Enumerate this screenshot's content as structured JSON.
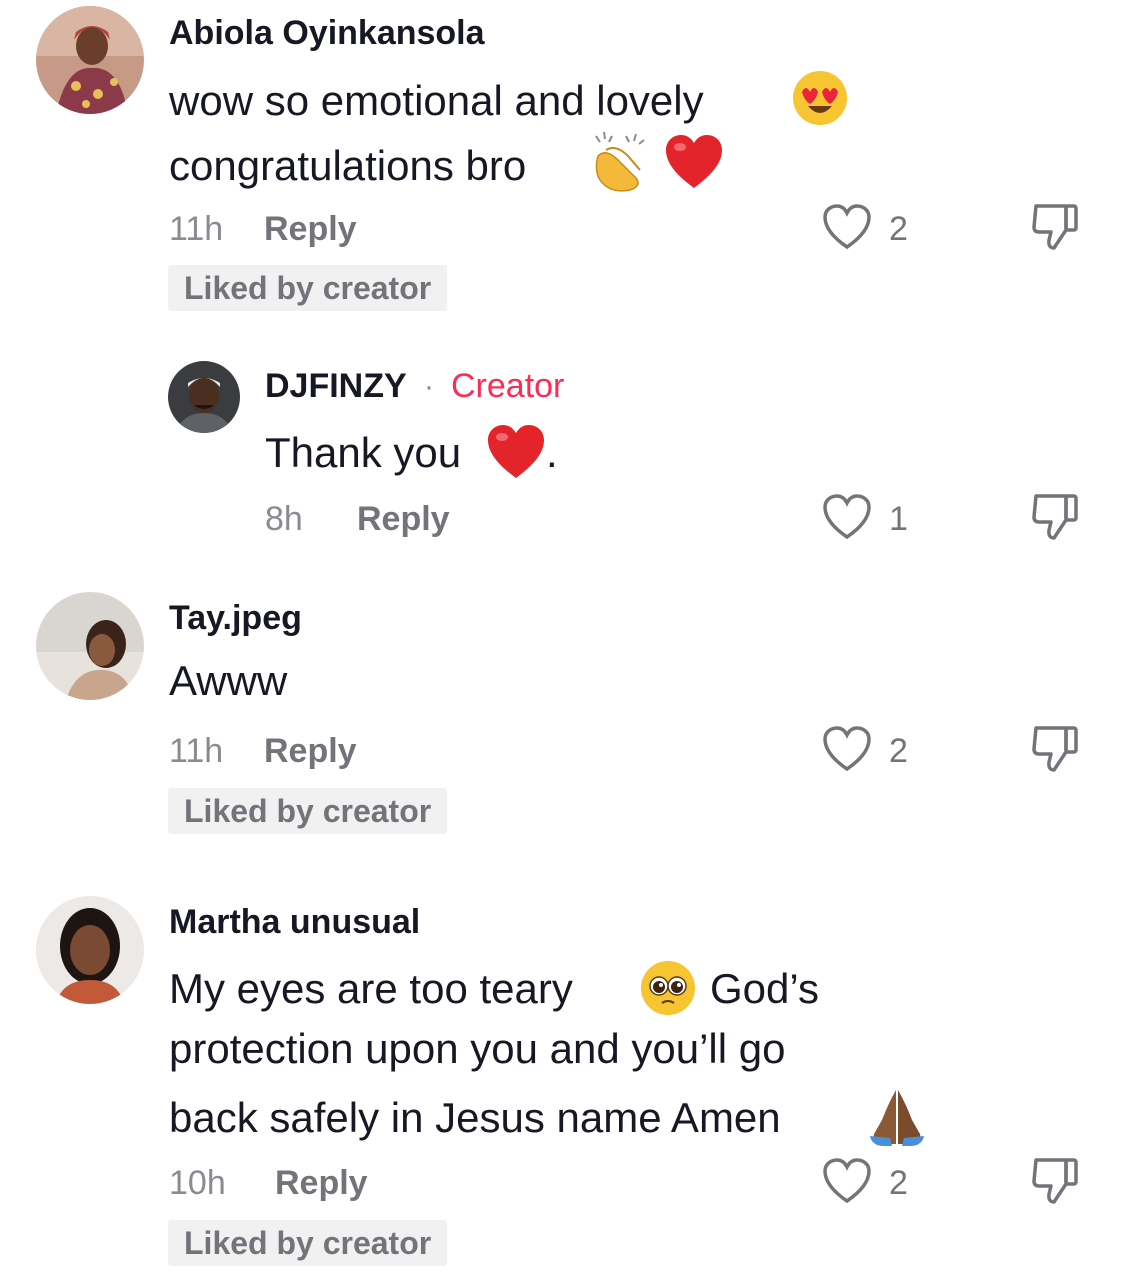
{
  "comments": [
    {
      "username": "Abiola Oyinkansola",
      "text_line1": "wow so emotional and lovely",
      "text_line2": "congratulations bro",
      "emoji_1": "heart-eyes-emoji",
      "emoji_2": "clapping-hands-emoji",
      "emoji_3": "red-heart-emoji",
      "time": "11h",
      "reply_label": "Reply",
      "like_count": "2",
      "badge": "Liked by creator"
    },
    {
      "username": "DJFINZY",
      "separator": "·",
      "creator_tag": "Creator",
      "text": "Thank you",
      "text_suffix": ".",
      "emoji_1": "red-heart-emoji",
      "time": "8h",
      "reply_label": "Reply",
      "like_count": "1"
    },
    {
      "username": "Tay.jpeg",
      "text": "Awww",
      "time": "11h",
      "reply_label": "Reply",
      "like_count": "2",
      "badge": "Liked by creator"
    },
    {
      "username": "Martha unusual",
      "text_line1a": "My eyes are too teary",
      "text_line1b": "God’s",
      "text_line2": "protection upon you and you’ll go",
      "text_line3": "back safely in Jesus name Amen",
      "emoji_1": "pleading-face-emoji",
      "emoji_2": "folded-hands-emoji",
      "time": "10h",
      "reply_label": "Reply",
      "like_count": "2",
      "badge": "Liked by creator"
    }
  ],
  "colors": {
    "creator_accent": "#fe2c55",
    "muted_text": "#8a8b91",
    "badge_bg": "#f1f1f2"
  }
}
